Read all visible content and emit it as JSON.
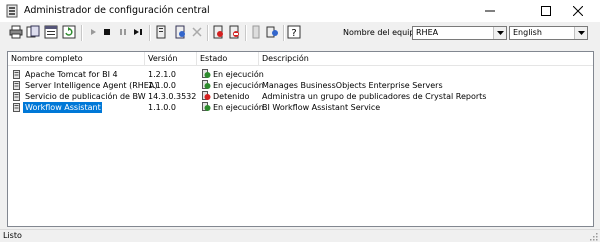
{
  "window": {
    "title": "Administrador de configuración central"
  },
  "toolbar": {
    "icons": [
      "print-icon",
      "preview-icon",
      "properties-icon",
      "refresh-icon",
      "start-icon",
      "stop-icon",
      "pause-icon",
      "resume-icon",
      "add-server-icon",
      "new-server-icon",
      "delete-icon",
      "disable-icon",
      "enable-icon",
      "metrics-icon",
      "web-tier-icon",
      "help-icon"
    ]
  },
  "machine": {
    "label": "Nombre del equipo:",
    "value": "RHEA"
  },
  "language": {
    "value": "English"
  },
  "table": {
    "columns": [
      "Nombre completo",
      "Versión",
      "Estado",
      "Descripción"
    ],
    "rows": [
      {
        "name": "Apache Tomcat for BI 4",
        "version": "1.2.1.0",
        "status": "En ejecución",
        "status_type": "running",
        "description": ""
      },
      {
        "name": "Server Intelligence Agent (RHEA)",
        "version": "1.1.0.0",
        "status": "En ejecución",
        "status_type": "running",
        "description": "Manages BusinessObjects Enterprise Servers"
      },
      {
        "name": "Servicio de publicación de BW",
        "version": "14.3.0.3532",
        "status": "Detenido",
        "status_type": "stopped",
        "description": "Administra un grupo de publicadores de Crystal Reports"
      },
      {
        "name": "Workflow Assistant",
        "version": "1.1.0.0",
        "status": "En ejecución",
        "status_type": "running",
        "description": "BI Workflow Assistant Service",
        "selected": true
      }
    ]
  },
  "statusbar": {
    "text": "Listo"
  },
  "colors": {
    "selection": "#0078d7",
    "running": "#2e8b2e",
    "stopped": "#d42020"
  }
}
